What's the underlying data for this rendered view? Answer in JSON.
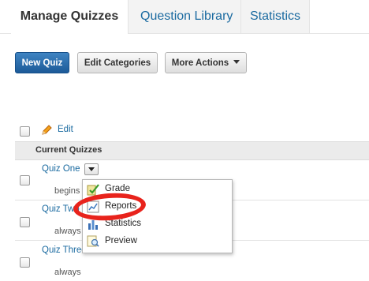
{
  "tabs": [
    {
      "label": "Manage Quizzes",
      "active": true
    },
    {
      "label": "Question Library",
      "active": false
    },
    {
      "label": "Statistics",
      "active": false
    }
  ],
  "toolbar": {
    "new_quiz": "New Quiz",
    "edit_categories": "Edit Categories",
    "more_actions": "More Actions"
  },
  "bulk": {
    "edit_label": "Edit",
    "edit_icon": "pencil-icon"
  },
  "table": {
    "header": "Current Quizzes",
    "rows": [
      {
        "title": "Quiz One",
        "availability": "begins"
      },
      {
        "title": "Quiz Two",
        "availability": "always"
      },
      {
        "title": "Quiz Three",
        "availability": "always"
      }
    ]
  },
  "context_menu": {
    "items": [
      {
        "label": "Grade",
        "icon": "grade-icon"
      },
      {
        "label": "Reports",
        "icon": "reports-icon"
      },
      {
        "label": "Statistics",
        "icon": "statistics-icon"
      },
      {
        "label": "Preview",
        "icon": "preview-icon"
      }
    ]
  },
  "colors": {
    "link": "#1a6aa0",
    "primary": "#1c5a98",
    "highlight": "#e8231c"
  }
}
